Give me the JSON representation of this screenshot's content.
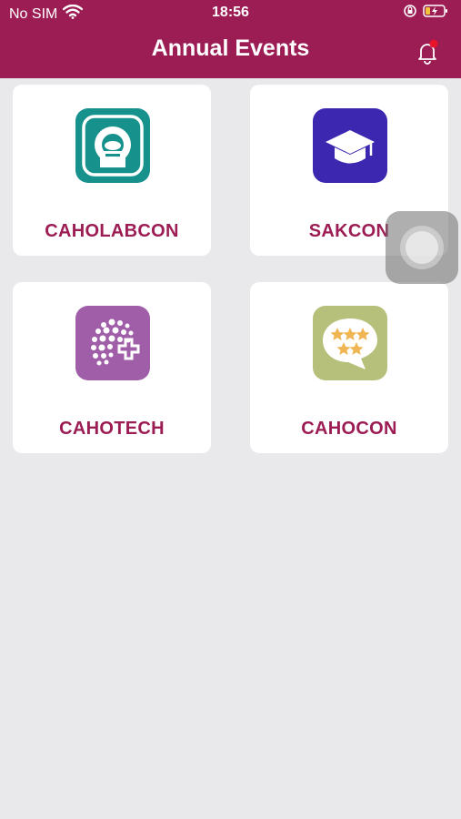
{
  "status_bar": {
    "carrier": "No SIM",
    "time": "18:56"
  },
  "header": {
    "title": "Annual Events"
  },
  "events": [
    {
      "label": "CAHOLABCON",
      "icon": "mri-scanner-icon",
      "color": "#17918c"
    },
    {
      "label": "SAKCON",
      "icon": "graduation-cap-icon",
      "color": "#3c27b0"
    },
    {
      "label": "CAHOTECH",
      "icon": "tech-globe-plus-icon",
      "color": "#a05ea8"
    },
    {
      "label": "CAHOCON",
      "icon": "star-rating-bubble-icon",
      "color": "#b7c07b"
    }
  ],
  "colors": {
    "primary": "#9c1c54",
    "background": "#e9e9eb"
  }
}
